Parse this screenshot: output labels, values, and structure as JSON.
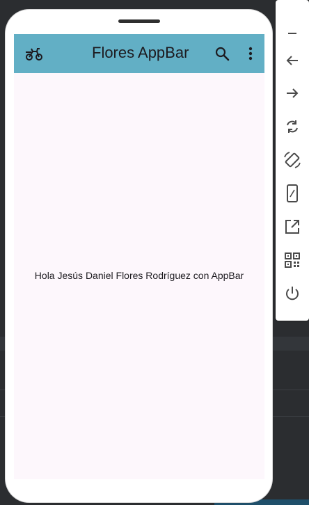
{
  "app": {
    "appbar_title": "Flores AppBar",
    "appbar_color": "#62afc5",
    "leading_icon": "bike-delivery-icon",
    "actions": [
      "search-icon",
      "more-vert-icon"
    ],
    "body_text": "Hola Jesús Daniel Flores Rodríguez con AppBar",
    "background_color": "#fdf7fc"
  },
  "emulator_toolbar": {
    "buttons": [
      {
        "name": "minimize-button",
        "icon": "minus-icon"
      },
      {
        "name": "back-button",
        "icon": "arrow-left-icon"
      },
      {
        "name": "forward-button",
        "icon": "arrow-right-icon"
      },
      {
        "name": "rotate-button",
        "icon": "rotate-icon"
      },
      {
        "name": "screen-rotation-button",
        "icon": "screen-rotation-icon"
      },
      {
        "name": "resize-device-button",
        "icon": "device-resize-icon"
      },
      {
        "name": "open-external-button",
        "icon": "open-in-new-icon"
      },
      {
        "name": "qr-code-button",
        "icon": "qr-code-icon"
      },
      {
        "name": "power-button",
        "icon": "power-icon"
      }
    ]
  }
}
